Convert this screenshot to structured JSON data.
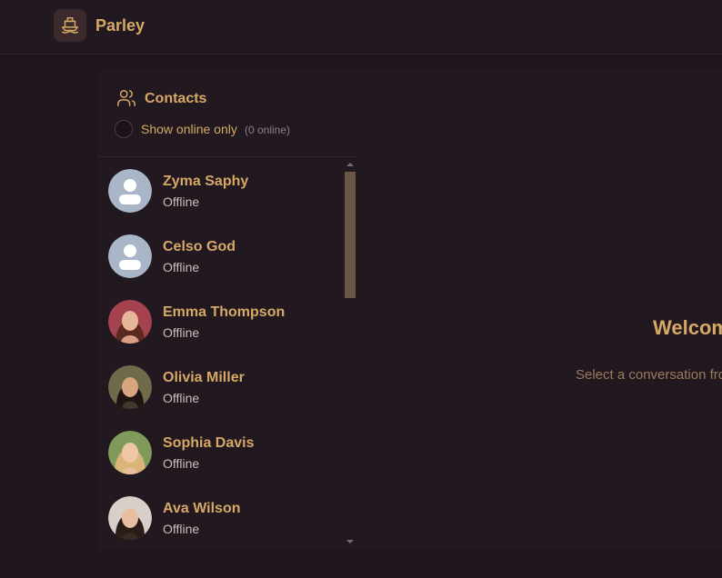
{
  "app": {
    "title": "Parley",
    "logo_icon": "ship-icon"
  },
  "contacts": {
    "title": "Contacts",
    "icon": "users-icon",
    "toggle_label": "Show online only",
    "online_count": "(0 online)",
    "items": [
      {
        "name": "Zyma Saphy",
        "status": "Offline",
        "avatar": "default-avatar"
      },
      {
        "name": "Celso God",
        "status": "Offline",
        "avatar": "default-avatar"
      },
      {
        "name": "Emma Thompson",
        "status": "Offline",
        "avatar": "photo-avatar"
      },
      {
        "name": "Olivia Miller",
        "status": "Offline",
        "avatar": "photo-avatar"
      },
      {
        "name": "Sophia Davis",
        "status": "Offline",
        "avatar": "photo-avatar"
      },
      {
        "name": "Ava Wilson",
        "status": "Offline",
        "avatar": "photo-avatar"
      }
    ]
  },
  "main": {
    "welcome": "Welcome",
    "hint": "Select a conversation from"
  },
  "colors": {
    "accent": "#d6a866",
    "background": "#1f161d",
    "panel": "#221920"
  }
}
